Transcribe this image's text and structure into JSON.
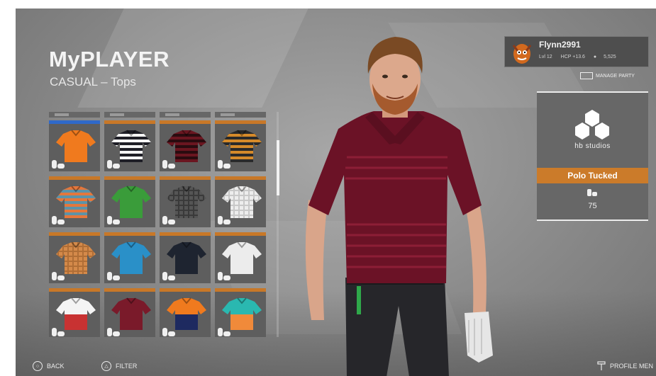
{
  "header": {
    "title": "MyPLAYER",
    "subtitle": "CASUAL – Tops"
  },
  "profile": {
    "username": "Flynn2991",
    "level": "Lvl 12",
    "handicap": "HCP +13.6",
    "currency": "5,525",
    "manage_party_label": "MANAGE PARTY"
  },
  "item_preview": {
    "brand": "hb studios",
    "item_name": "Polo Tucked",
    "price": "75"
  },
  "footer": {
    "back_label": "BACK",
    "filter_label": "FILTER",
    "profile_menu_label": "PROFILE MEN"
  },
  "colors": {
    "accent_orange": "#cb7b2a",
    "selected_blue": "#2f69c9"
  },
  "shirt_grid": [
    {
      "style": "solid",
      "base": "#f07a1e",
      "stripe": "#f07a1e",
      "selected": true
    },
    {
      "style": "stripes",
      "base": "#1e1e26",
      "stripe": "#f4f4f4",
      "selected": false
    },
    {
      "style": "stripes",
      "base": "#6a1620",
      "stripe": "#2a0c10",
      "selected": false
    },
    {
      "style": "stripes",
      "base": "#2a2a2a",
      "stripe": "#d58a2a",
      "selected": false
    },
    {
      "style": "stripes",
      "base": "#e4773c",
      "stripe": "#5d93a8",
      "selected": false
    },
    {
      "style": "solid",
      "base": "#3a9c3a",
      "stripe": "#3a9c3a",
      "selected": false
    },
    {
      "style": "plaid",
      "base": "#555555",
      "stripe": "#3a3a3a",
      "selected": false
    },
    {
      "style": "plaid",
      "base": "#ededed",
      "stripe": "#c8c8c8",
      "selected": false
    },
    {
      "style": "plaid",
      "base": "#d48a4a",
      "stripe": "#b06e36",
      "selected": false
    },
    {
      "style": "solid",
      "base": "#2a90c8",
      "stripe": "#2a90c8",
      "selected": false
    },
    {
      "style": "solid",
      "base": "#1e2430",
      "stripe": "#1e2430",
      "selected": false
    },
    {
      "style": "solid",
      "base": "#ececec",
      "stripe": "#ececec",
      "selected": false
    },
    {
      "style": "block",
      "base": "#f4f4f4",
      "stripe": "#c83232",
      "selected": false
    },
    {
      "style": "solid",
      "base": "#7a1a2a",
      "stripe": "#7a1a2a",
      "selected": false
    },
    {
      "style": "block",
      "base": "#f07a1e",
      "stripe": "#1e2a60",
      "selected": false
    },
    {
      "style": "block",
      "base": "#2ab8b0",
      "stripe": "#f08a3a",
      "selected": false
    }
  ]
}
